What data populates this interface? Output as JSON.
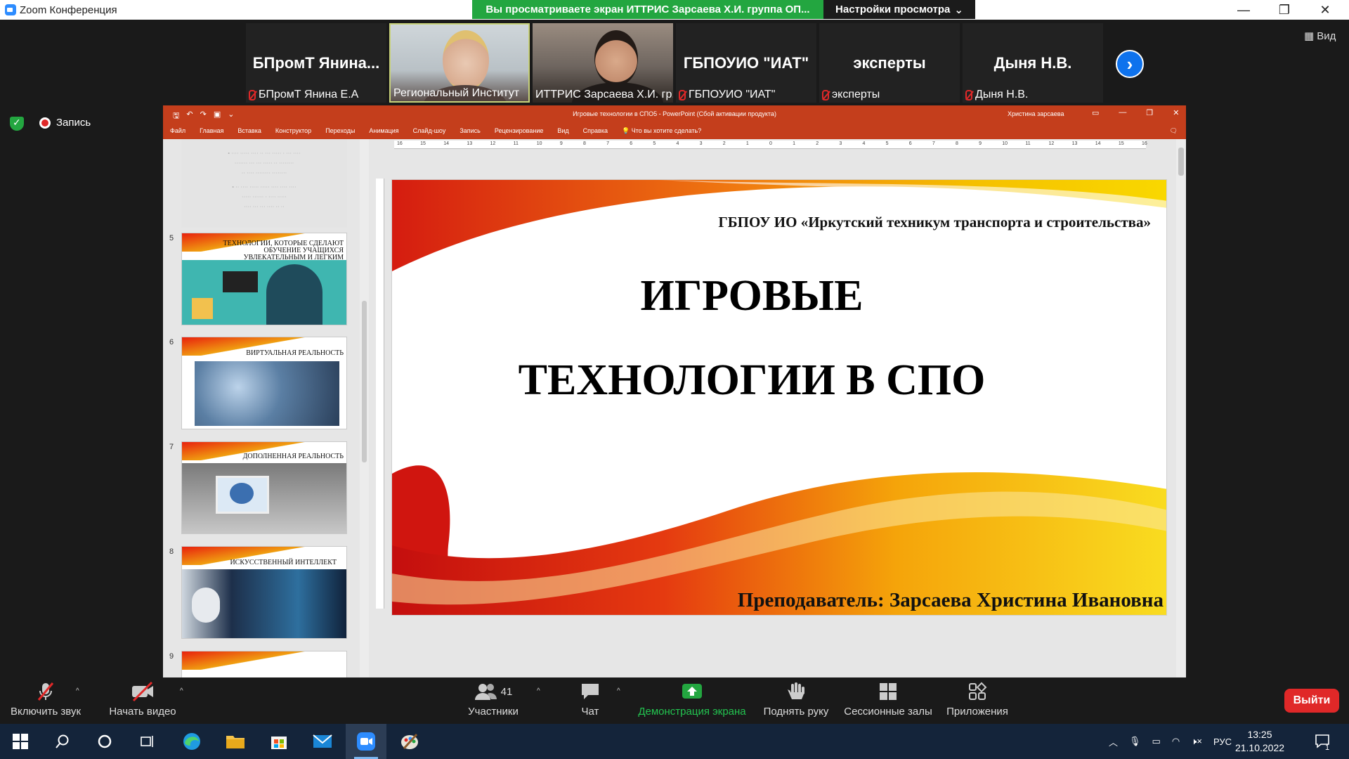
{
  "window": {
    "title": "Zoom Конференция",
    "share_banner": "Вы просматриваете экран ИТТРИС Зарсаева Х.И. группа ОП...",
    "view_options_label": "Настройки просмотра"
  },
  "gallery": {
    "tiles": [
      {
        "big_name": "БПромТ Янина...",
        "label": "БПромТ Янина Е.А",
        "muted": true
      },
      {
        "big_name": "",
        "label": "Региональный Институт",
        "muted": false
      },
      {
        "big_name": "",
        "label": "ИТТРИС Зарсаева Х.И. гр...",
        "muted": false
      },
      {
        "big_name": "ГБПОУИО \"ИАТ\"",
        "label": "ГБПОУИО \"ИАТ\"",
        "muted": true
      },
      {
        "big_name": "эксперты",
        "label": "эксперты",
        "muted": true
      },
      {
        "big_name": "Дыня Н.В.",
        "label": "Дыня Н.В.",
        "muted": true
      }
    ],
    "view_label": "Вид"
  },
  "recording": {
    "label": "Запись"
  },
  "ppt": {
    "doc_title": "Игровые технологии в СПО5  -  PowerPoint (Сбой активации продукта)",
    "user": "Христина зарсаева",
    "ribbon_tabs": [
      "Файл",
      "Главная",
      "Вставка",
      "Конструктор",
      "Переходы",
      "Анимация",
      "Слайд-шоу",
      "Запись",
      "Рецензирование",
      "Вид",
      "Справка",
      "Что вы хотите сделать?"
    ],
    "thumbnails": [
      {
        "num": "5",
        "caption": "ТЕХНОЛОГИИ, КОТОРЫЕ СДЕЛАЮТ ОБУЧЕНИЕ УЧАЩИХСЯ УВЛЕКАТЕЛЬНЫМ И ЛЕГКИМ"
      },
      {
        "num": "6",
        "caption": "ВИРТУАЛЬНАЯ РЕАЛЬНОСТЬ"
      },
      {
        "num": "7",
        "caption": "ДОПОЛНЕННАЯ РЕАЛЬНОСТЬ"
      },
      {
        "num": "8",
        "caption": "ИСКУССТВЕННЫЙ ИНТЕЛЛЕКТ"
      },
      {
        "num": "9",
        "caption": ""
      }
    ],
    "ruler_h": [
      "16",
      "15",
      "14",
      "13",
      "12",
      "11",
      "10",
      "9",
      "8",
      "7",
      "6",
      "5",
      "4",
      "3",
      "2",
      "1",
      "0",
      "1",
      "2",
      "3",
      "4",
      "5",
      "6",
      "7",
      "8",
      "9",
      "10",
      "11",
      "12",
      "13",
      "14",
      "15",
      "16"
    ],
    "slide": {
      "org": "ГБПОУ ИО «Иркутский техникум транспорта и строительства»",
      "title_line1": "ИГРОВЫЕ",
      "title_line2": "ТЕХНОЛОГИИ В СПО",
      "teacher": "Преподаватель: Зарсаева Христина Ивановна"
    }
  },
  "controls": {
    "unmute": "Включить звук",
    "start_video": "Начать видео",
    "participants": "Участники",
    "participants_count": "41",
    "chat": "Чат",
    "share_screen": "Демонстрация экрана",
    "raise_hand": "Поднять руку",
    "breakout": "Сессионные залы",
    "apps": "Приложения",
    "leave": "Выйти"
  },
  "taskbar": {
    "lang": "РУС",
    "time": "13:25",
    "date": "21.10.2022",
    "notif_count": "1"
  },
  "colors": {
    "ppt_accent": "#c43e1c",
    "zoom_green": "#23a640",
    "zoom_blue": "#0e72ed",
    "leave_red": "#e02828"
  }
}
